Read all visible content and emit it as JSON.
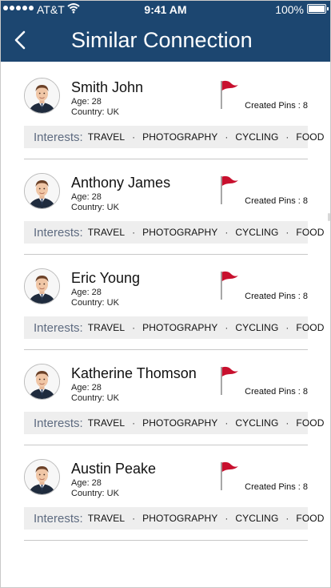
{
  "status_bar": {
    "carrier": "AT&T",
    "time": "9:41 AM",
    "battery": "100%"
  },
  "header": {
    "title": "Similar Connection",
    "back_icon": "chevron-left-icon"
  },
  "colors": {
    "header_bg": "#1c4670",
    "interests_bg": "#eeeeee",
    "flag": "#c8102e"
  },
  "interests_label": "Interests:",
  "people": [
    {
      "name": "Smith John",
      "age": "Age: 28",
      "country": "Country: UK",
      "pins": "Created Pins : 8",
      "interests": [
        "TRAVEL",
        "PHOTOGRAPHY",
        "CYCLING",
        "FOOD"
      ]
    },
    {
      "name": "Anthony James",
      "age": "Age: 28",
      "country": "Country: UK",
      "pins": "Created Pins : 8",
      "interests": [
        "TRAVEL",
        "PHOTOGRAPHY",
        "CYCLING",
        "FOOD"
      ]
    },
    {
      "name": "Eric Young",
      "age": "Age: 28",
      "country": "Country: UK",
      "pins": "Created Pins : 8",
      "interests": [
        "TRAVEL",
        "PHOTOGRAPHY",
        "CYCLING",
        "FOOD"
      ]
    },
    {
      "name": "Katherine Thomson",
      "age": "Age: 28",
      "country": "Country: UK",
      "pins": "Created Pins : 8",
      "interests": [
        "TRAVEL",
        "PHOTOGRAPHY",
        "CYCLING",
        "FOOD"
      ]
    },
    {
      "name": "Austin Peake",
      "age": "Age: 28",
      "country": "Country: UK",
      "pins": "Created Pins : 8",
      "interests": [
        "TRAVEL",
        "PHOTOGRAPHY",
        "CYCLING",
        "FOOD"
      ]
    }
  ]
}
